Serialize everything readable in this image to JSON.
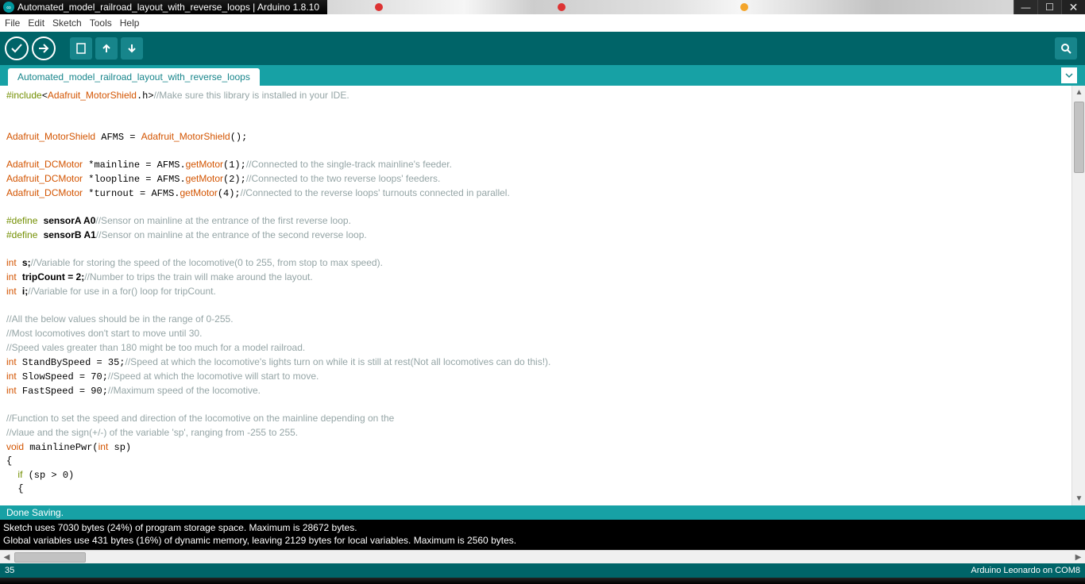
{
  "window": {
    "title": "Automated_model_railroad_layout_with_reverse_loops | Arduino 1.8.10"
  },
  "menu": {
    "items": [
      "File",
      "Edit",
      "Sketch",
      "Tools",
      "Help"
    ]
  },
  "toolbar": {
    "verify": "verify",
    "upload": "upload",
    "new": "new",
    "open": "open",
    "save": "save",
    "serial": "serial-monitor"
  },
  "tab": {
    "name": "Automated_model_railroad_layout_with_reverse_loops"
  },
  "code": {
    "lines": [
      {
        "t": "pre",
        "s": [
          "#include<"
        ]
      },
      {
        "t": "raw",
        "html": "<span class='tok-pre'>#include</span>&lt;<span class='tok-type'>Adafruit_MotorShield</span>.h&gt;<span class='tok-cmt'>//Make sure this library is installed in your IDE.</span>"
      },
      {
        "t": "blank"
      },
      {
        "t": "blank"
      },
      {
        "t": "raw",
        "html": "<span class='tok-type'>Adafruit_MotorShield</span> AFMS = <span class='tok-type'>Adafruit_MotorShield</span>();"
      },
      {
        "t": "blank"
      },
      {
        "t": "raw",
        "html": "<span class='tok-type'>Adafruit_DCMotor</span> *mainline = AFMS.<span class='tok-func'>getMotor</span>(1);<span class='tok-cmt'>//Connected to the single-track mainline's feeder.</span>"
      },
      {
        "t": "raw",
        "html": "<span class='tok-type'>Adafruit_DCMotor</span> *loopline = AFMS.<span class='tok-func'>getMotor</span>(2);<span class='tok-cmt'>//Connected to the two reverse loops' feeders.</span>"
      },
      {
        "t": "raw",
        "html": "<span class='tok-type'>Adafruit_DCMotor</span> *turnout = AFMS.<span class='tok-func'>getMotor</span>(4);<span class='tok-cmt'>//Connected to the reverse loops' turnouts connected in parallel.</span>"
      },
      {
        "t": "blank"
      },
      {
        "t": "raw",
        "html": "<span class='tok-pre'>#define</span> <b>sensorA A0</b><span class='tok-cmt'>//Sensor on mainline at the entrance of the first reverse loop.</span>"
      },
      {
        "t": "raw",
        "html": "<span class='tok-pre'>#define</span> <b>sensorB A1</b><span class='tok-cmt'>//Sensor on mainline at the entrance of the second reverse loop.</span>"
      },
      {
        "t": "blank"
      },
      {
        "t": "raw",
        "html": "<span class='tok-type'>int</span> <b>s;</b><span class='tok-cmt'>//Variable for storing the speed of the locomotive(0 to 255, from stop to max speed).</span>"
      },
      {
        "t": "raw",
        "html": "<span class='tok-type'>int</span> <b>tripCount = 2;</b><span class='tok-cmt'>//Number to trips the train will make around the layout.</span>"
      },
      {
        "t": "raw",
        "html": "<span class='tok-type'>int</span> <b>i;</b><span class='tok-cmt'>//Variable for use in a for() loop for tripCount.</span>"
      },
      {
        "t": "blank"
      },
      {
        "t": "raw",
        "html": "<span class='tok-cmt'>//All the below values should be in the range of 0-255.</span>"
      },
      {
        "t": "raw",
        "html": "<span class='tok-cmt'>//Most locomotives don't start to move until 30.</span>"
      },
      {
        "t": "raw",
        "html": "<span class='tok-cmt'>//Speed vales greater than 180 might be too much for a model railroad.</span>"
      },
      {
        "t": "raw",
        "html": "<span class='tok-type'>int</span> StandBySpeed = 35;<span class='tok-cmt'>//Speed at which the locomotive's lights turn on while it is still at rest(Not all locomotives can do this!).</span>"
      },
      {
        "t": "raw",
        "html": "<span class='tok-type'>int</span> SlowSpeed = 70;<span class='tok-cmt'>//Speed at which the locomotive will start to move.</span>"
      },
      {
        "t": "raw",
        "html": "<span class='tok-type'>int</span> FastSpeed = 90;<span class='tok-cmt'>//Maximum speed of the locomotive.</span>"
      },
      {
        "t": "blank"
      },
      {
        "t": "raw",
        "html": "<span class='tok-cmt'>//Function to set the speed and direction of the locomotive on the mainline depending on the</span>"
      },
      {
        "t": "raw",
        "html": "<span class='tok-cmt'>//vlaue and the sign(+/-) of the variable 'sp', ranging from -255 to 255.</span>"
      },
      {
        "t": "raw",
        "html": "<span class='tok-type'>void</span> mainlinePwr(<span class='tok-type'>int</span> sp)"
      },
      {
        "t": "raw",
        "html": "{"
      },
      {
        "t": "raw",
        "html": "  <span class='tok-def'>if</span> (sp &gt; 0)"
      },
      {
        "t": "raw",
        "html": "  {"
      }
    ]
  },
  "status_message": "Done Saving.",
  "console": {
    "line1": "Sketch uses 7030 bytes (24%) of program storage space. Maximum is 28672 bytes.",
    "line2": "Global variables use 431 bytes (16%) of dynamic memory, leaving 2129 bytes for local variables. Maximum is 2560 bytes."
  },
  "statusbar": {
    "line": "35",
    "board": "Arduino Leonardo on COM8"
  }
}
